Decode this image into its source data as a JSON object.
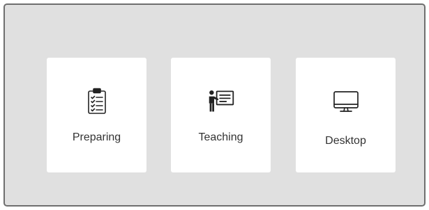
{
  "cards": [
    {
      "label": "Preparing",
      "icon": "clipboard-checklist-icon"
    },
    {
      "label": "Teaching",
      "icon": "teacher-board-icon"
    },
    {
      "label": "Desktop",
      "icon": "monitor-icon"
    }
  ]
}
